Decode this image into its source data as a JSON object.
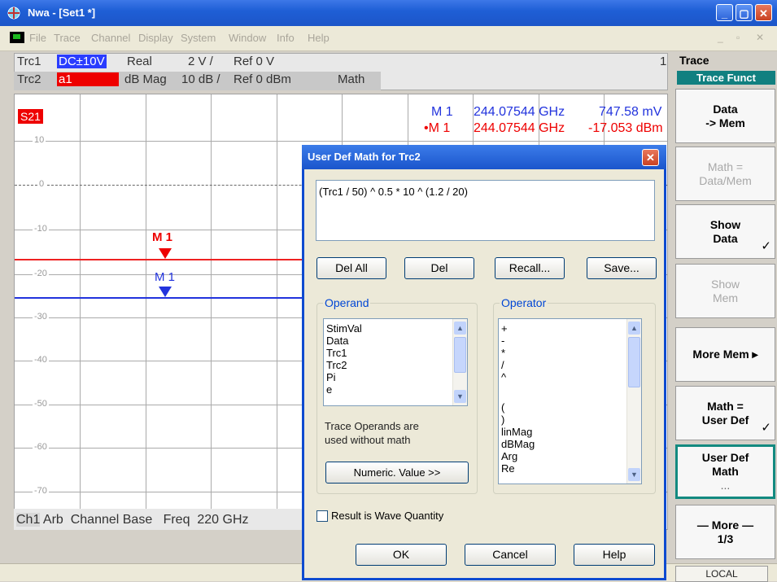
{
  "window": {
    "title": "Nwa - [Set1 *]",
    "min": "_",
    "max": "▢",
    "close": "✕"
  },
  "menu": [
    "File",
    "Trace",
    "Channel",
    "Display",
    "System",
    "Window",
    "Info",
    "Help"
  ],
  "mdi_buttons": [
    "_",
    "▫",
    "✕"
  ],
  "info": {
    "trc1": {
      "name": "Trc1",
      "badge": "DC±10V",
      "format": "Real",
      "scale": "2 V /",
      "ref": "Ref 0 V"
    },
    "trc2": {
      "name": "Trc2",
      "badge": "a1",
      "format": "dB Mag",
      "scale": "10 dB /",
      "ref": "Ref 0 dBm",
      "math": "Math"
    },
    "channel_num": "1"
  },
  "graph": {
    "s21": "S21",
    "y_labels": [
      "10",
      "0",
      "-10",
      "-20",
      "-30",
      "-40",
      "-50",
      "-60",
      "-70"
    ],
    "marker_red": "M 1",
    "marker_blue": "M 1",
    "marker_rows": [
      {
        "name": "M 1",
        "freq": "244.07544 GHz",
        "value": "747.58 mV",
        "color": "#2233dd"
      },
      {
        "name": "•M 1",
        "freq": "244.07544 GHz",
        "value": "-17.053 dBm",
        "color": "#ee0000"
      }
    ]
  },
  "status": {
    "ch": "Ch1",
    "text": "Arb  Channel Base   Freq  220 GHz",
    "local": "LOCAL"
  },
  "panel": {
    "title": "Trace",
    "subtitle": "Trace Funct",
    "softkeys": [
      {
        "l1": "Data",
        "l2": "-> Mem",
        "disabled": false,
        "check": false
      },
      {
        "l1": "Math =",
        "l2": "Data/Mem",
        "disabled": true,
        "check": false
      },
      {
        "l1": "Show",
        "l2": "Data",
        "disabled": false,
        "check": true
      },
      {
        "l1": "Show",
        "l2": "Mem",
        "disabled": true,
        "check": false
      },
      {
        "l1": "More Mem ▸",
        "l2": "",
        "disabled": false,
        "check": false
      },
      {
        "l1": "Math =",
        "l2": "User Def",
        "disabled": false,
        "check": true
      },
      {
        "l1": "User Def",
        "l2": "Math",
        "l3": "...",
        "disabled": false,
        "check": false,
        "active": true
      },
      {
        "l1": "— More —",
        "l2": "1/3",
        "disabled": false,
        "check": false
      }
    ],
    "checkmark": "✓"
  },
  "dialog": {
    "title": "User Def Math for Trc2",
    "close": "✕",
    "expression": "(Trc1 / 50) ^ 0.5 * 10 ^ (1.2 / 20)",
    "buttons": {
      "del_all": "Del All",
      "del": "Del",
      "recall": "Recall...",
      "save": "Save..."
    },
    "operand_label": "Operand",
    "operands": [
      "StimVal",
      "Data",
      "Trc1",
      "Trc2",
      "Pi",
      "e"
    ],
    "operator_label": "Operator",
    "operators": [
      "+",
      "-",
      "*",
      "/",
      "^",
      "(",
      ")",
      "linMag",
      "dBMag",
      "Arg",
      "Re"
    ],
    "note_1": "Trace Operands are",
    "note_2": "used without math",
    "numeric": "Numeric. Value >>",
    "wave": "Result is Wave Quantity",
    "ok": "OK",
    "cancel": "Cancel",
    "help": "Help",
    "scroll_up": "▲",
    "scroll_down": "▼"
  }
}
